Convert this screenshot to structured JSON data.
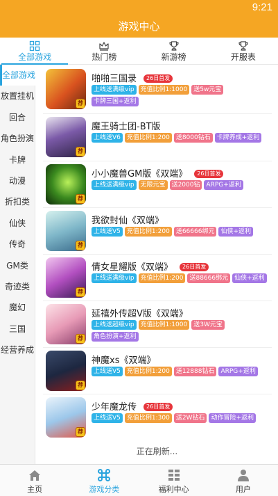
{
  "status_bar": {
    "time": "9:21"
  },
  "header": {
    "title": "游戏中心"
  },
  "top_tabs": [
    {
      "label": "全部游戏",
      "icon": "grid-icon",
      "active": true
    },
    {
      "label": "热门榜",
      "icon": "crown-icon",
      "active": false
    },
    {
      "label": "新游榜",
      "icon": "trophy-icon",
      "active": false
    },
    {
      "label": "开服表",
      "icon": "trophy-icon",
      "active": false
    }
  ],
  "sidebar": {
    "items": [
      "全部游戏",
      "放置挂机",
      "回合",
      "角色扮演",
      "卡牌",
      "动漫",
      "折扣类",
      "仙侠",
      "传奇",
      "GM类",
      "奇迹类",
      "魔幻",
      "三国",
      "经营养成"
    ]
  },
  "games": [
    {
      "name": "啪啪三国录",
      "badge": "26日首发",
      "tags": [
        "上线送满级vip",
        "充值比例1:1000",
        "送5w元宝",
        "卡牌三国+返利"
      ]
    },
    {
      "name": "魔王骑士团-BT版",
      "badge": "",
      "tags": [
        "上线送V6",
        "充值比例1:200",
        "送8000钻石",
        "卡牌养成+返利"
      ]
    },
    {
      "name": "小小魔兽GM版《双端》",
      "badge": "26日首发",
      "tags": [
        "上线送满级vip",
        "无限元宝",
        "送2000钻",
        "ARPG+返利"
      ]
    },
    {
      "name": "我欲封仙《双端》",
      "badge": "",
      "tags": [
        "上线送V5",
        "充值比例1:200",
        "送66666绑元",
        "仙侠+返利"
      ]
    },
    {
      "name": "倩女星耀版《双端》",
      "badge": "26日首发",
      "tags": [
        "上线送满级vip",
        "充值比例1:200",
        "送88666绑元",
        "仙侠+返利"
      ]
    },
    {
      "name": "延禧外传超V版《双端》",
      "badge": "",
      "tags": [
        "上线送超级vip",
        "充值比例1:1000",
        "送3W元宝",
        "角色扮演+返利"
      ]
    },
    {
      "name": "神魔xs《双端》",
      "badge": "",
      "tags": [
        "上线送V5",
        "充值比例1:200",
        "送12888钻石",
        "ARPG+返利"
      ]
    },
    {
      "name": "少年魔龙传",
      "badge": "26日首发",
      "tags": [
        "上线送V5",
        "充值比例1:300",
        "送2W钻石",
        "动作冒险+返利"
      ]
    }
  ],
  "thumb_flag": "荐",
  "loading_text": "正在刷新...",
  "bottom_tabs": [
    {
      "label": "主页",
      "icon": "home-icon",
      "active": false
    },
    {
      "label": "游戏分类",
      "icon": "command-icon",
      "active": true
    },
    {
      "label": "福利中心",
      "icon": "list-grid-icon",
      "active": false
    },
    {
      "label": "用户",
      "icon": "user-icon",
      "active": false
    }
  ],
  "colors": {
    "accent": "#f5a623",
    "active_blue": "#2aa4de",
    "badge_red": "#e7353b",
    "tag_blue": "#2eb3e8",
    "tag_orange": "#f29f3a",
    "tag_pink": "#f0748a",
    "tag_violet": "#a477e6"
  }
}
